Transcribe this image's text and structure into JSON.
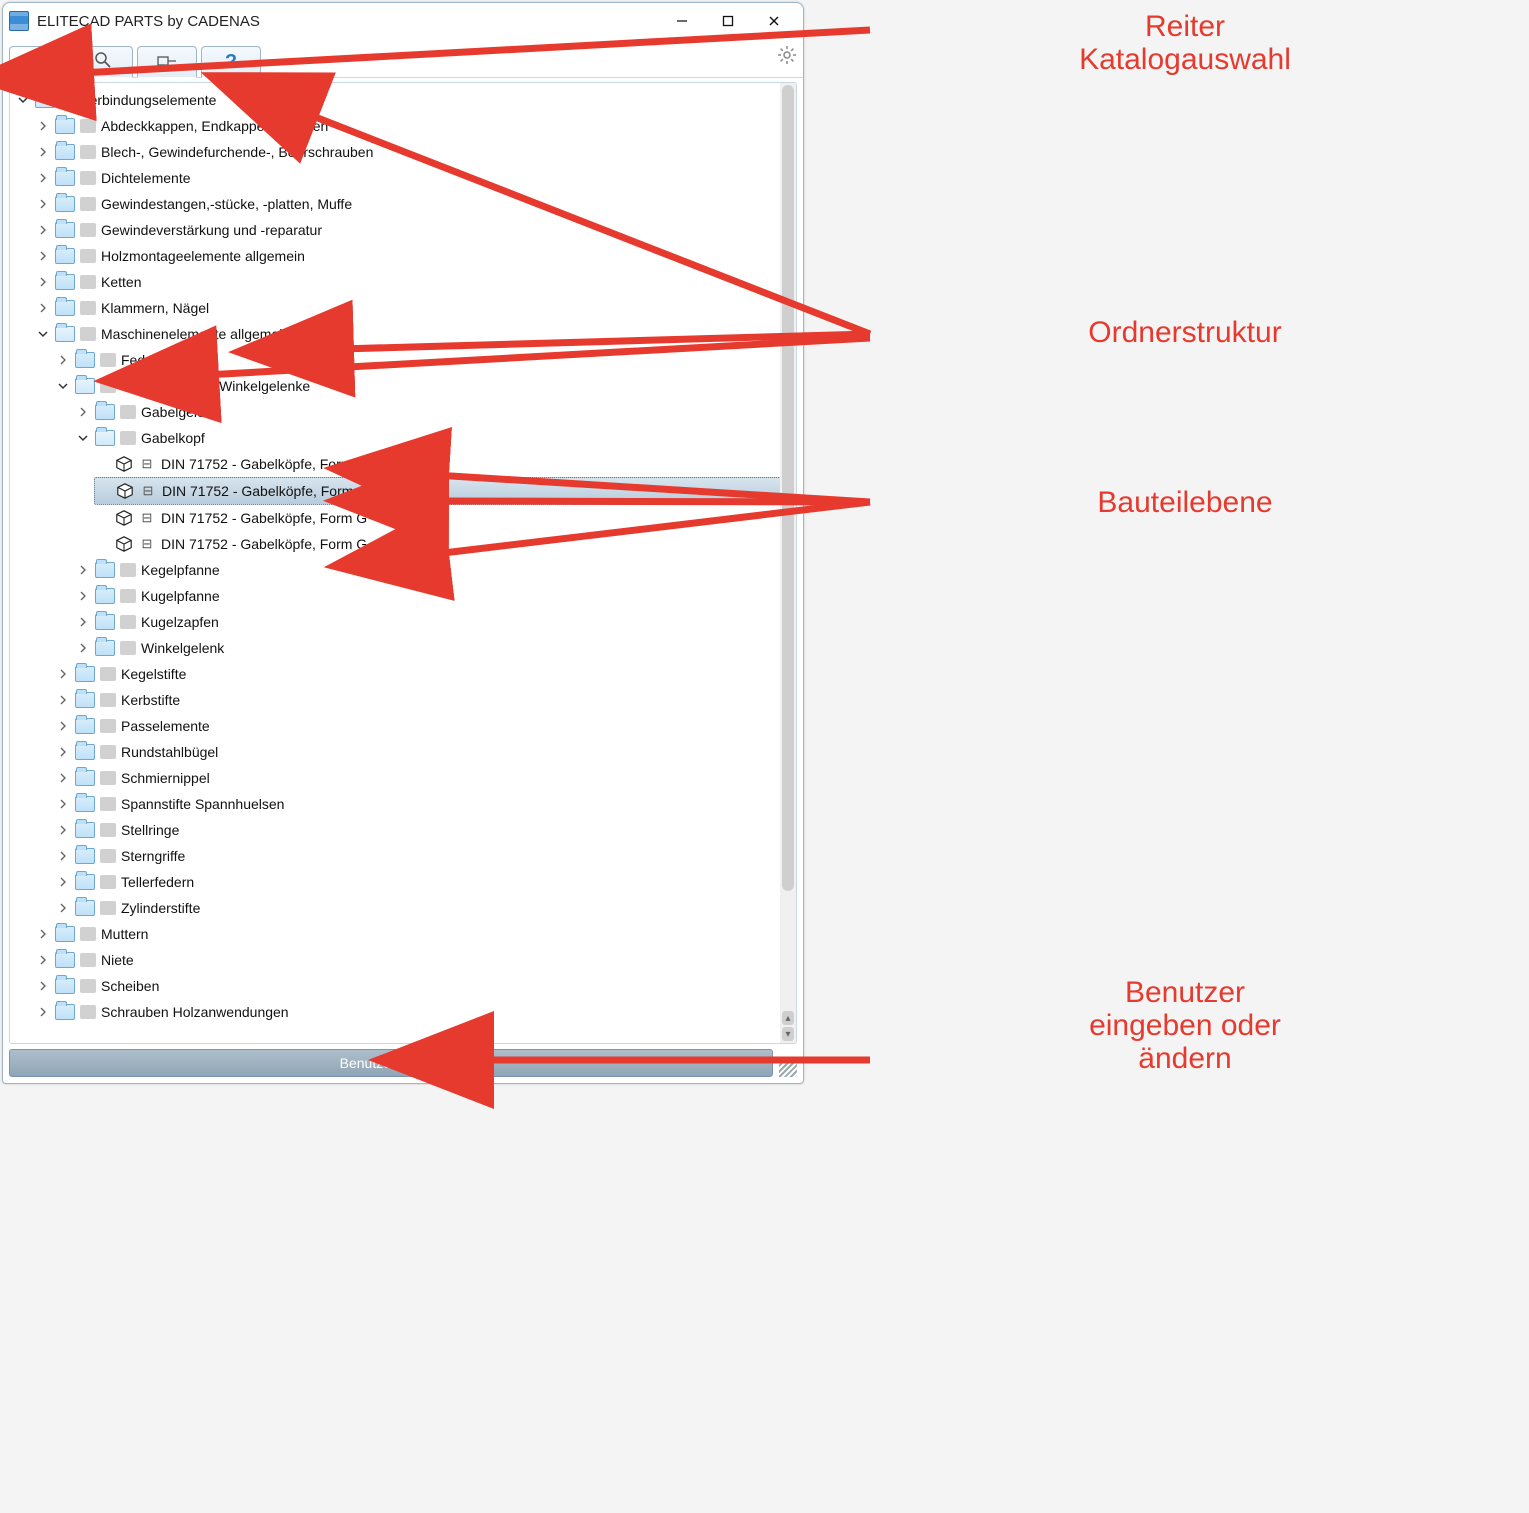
{
  "window": {
    "title": "ELITECAD PARTS by CADENAS"
  },
  "toolbar": {
    "tab_catalog": "catalog",
    "tab_search": "search",
    "tab_part": "part",
    "tab_help": "?",
    "gear": "settings"
  },
  "bottom": {
    "user_button": "Benutzerdaten..."
  },
  "annotations": {
    "catalog_tab": "Reiter\nKatalogauswahl",
    "folder_structure": "Ordnerstruktur",
    "part_level": "Bauteilebene",
    "user_button": "Benutzer\neingeben oder\nändern"
  },
  "tree": [
    {
      "label": "Verbindungselemente",
      "type": "folder",
      "expanded": true,
      "children": [
        {
          "label": "Abdeckkappen, Endkappen, Stopfen",
          "type": "folder"
        },
        {
          "label": "Blech-, Gewindefurchende-, Bohrschrauben",
          "type": "folder"
        },
        {
          "label": "Dichtelemente",
          "type": "folder"
        },
        {
          "label": "Gewindestangen,-stücke, -platten, Muffe",
          "type": "folder"
        },
        {
          "label": "Gewindeverstärkung und -reparatur",
          "type": "folder"
        },
        {
          "label": "Holzmontageelemente allgemein",
          "type": "folder"
        },
        {
          "label": "Ketten",
          "type": "folder"
        },
        {
          "label": "Klammern, Nägel",
          "type": "folder"
        },
        {
          "label": "Maschinenelemente allgemein",
          "type": "folder",
          "expanded": true,
          "children": [
            {
              "label": "Federn",
              "type": "folder"
            },
            {
              "label": "Gabelgelenke / Winkelgelenke",
              "type": "folder",
              "expanded": true,
              "children": [
                {
                  "label": "Gabelgelenk",
                  "type": "folder"
                },
                {
                  "label": "Gabelkopf",
                  "type": "folder",
                  "expanded": true,
                  "children": [
                    {
                      "label": "DIN 71752 - Gabelköpfe, Form G",
                      "type": "part"
                    },
                    {
                      "label": "DIN 71752 - Gabelköpfe, Form G",
                      "type": "part",
                      "selected": true
                    },
                    {
                      "label": "DIN 71752 - Gabelköpfe, Form G",
                      "type": "part"
                    },
                    {
                      "label": "DIN 71752 - Gabelköpfe, Form G",
                      "type": "part"
                    }
                  ]
                },
                {
                  "label": "Kegelpfanne",
                  "type": "folder"
                },
                {
                  "label": "Kugelpfanne",
                  "type": "folder"
                },
                {
                  "label": "Kugelzapfen",
                  "type": "folder"
                },
                {
                  "label": "Winkelgelenk",
                  "type": "folder"
                }
              ]
            },
            {
              "label": "Kegelstifte",
              "type": "folder"
            },
            {
              "label": "Kerbstifte",
              "type": "folder"
            },
            {
              "label": "Passelemente",
              "type": "folder"
            },
            {
              "label": "Rundstahlbügel",
              "type": "folder"
            },
            {
              "label": "Schmiernippel",
              "type": "folder"
            },
            {
              "label": "Spannstifte Spannhuelsen",
              "type": "folder"
            },
            {
              "label": "Stellringe",
              "type": "folder"
            },
            {
              "label": "Sterngriffe",
              "type": "folder"
            },
            {
              "label": "Tellerfedern",
              "type": "folder"
            },
            {
              "label": "Zylinderstifte",
              "type": "folder"
            }
          ]
        },
        {
          "label": "Muttern",
          "type": "folder"
        },
        {
          "label": "Niete",
          "type": "folder"
        },
        {
          "label": "Scheiben",
          "type": "folder"
        },
        {
          "label": "Schrauben Holzanwendungen",
          "type": "folder"
        }
      ]
    }
  ]
}
